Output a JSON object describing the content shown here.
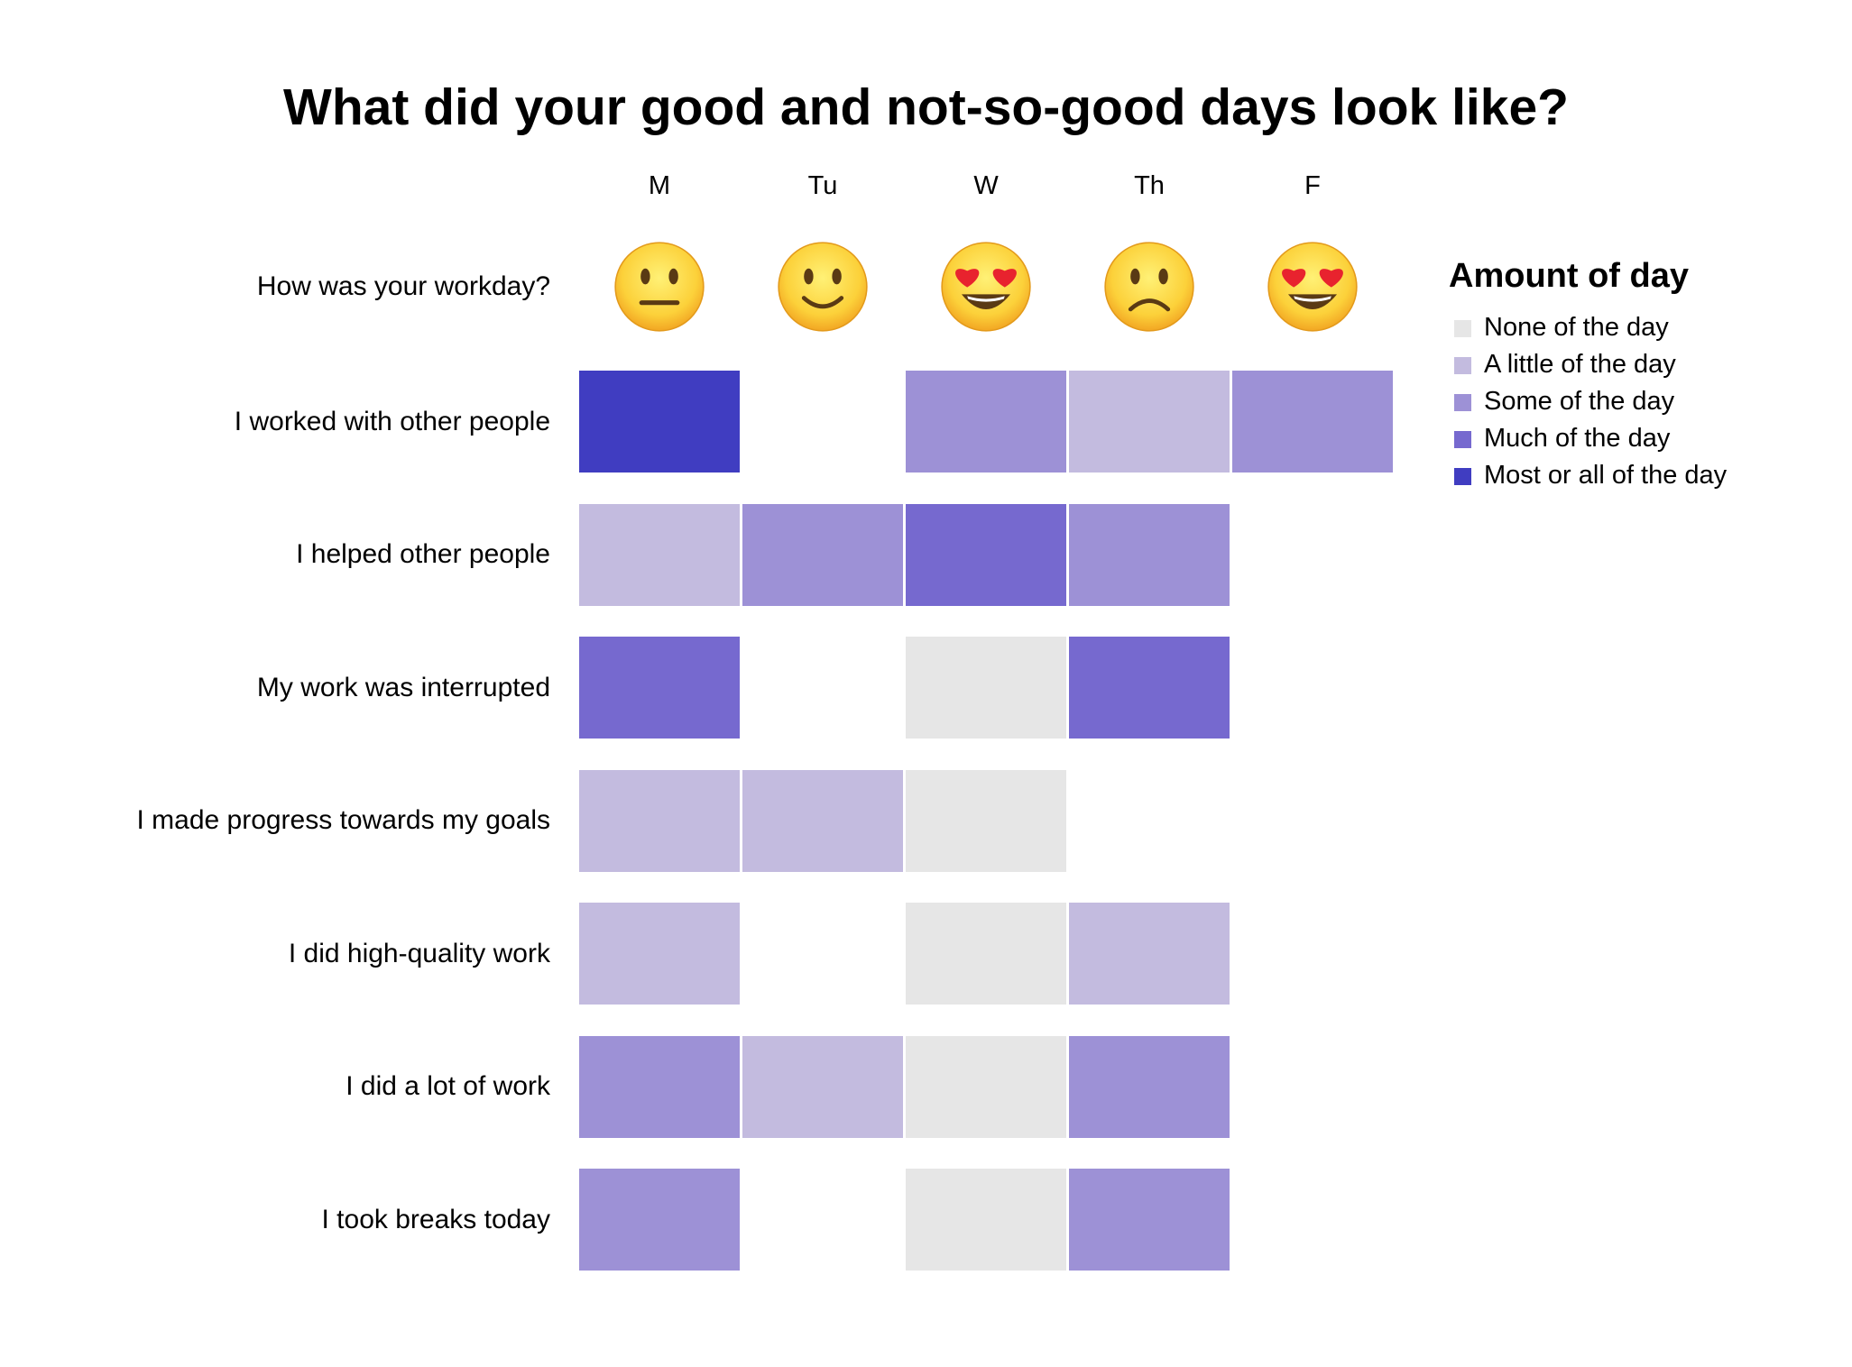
{
  "chart_data": {
    "type": "heatmap",
    "title": "What did your good and not-so-good days look like?",
    "days": [
      "M",
      "Tu",
      "W",
      "Th",
      "F"
    ],
    "mood_row": {
      "label": "How was your workday?",
      "values": [
        "neutral-face-icon",
        "slightly-smiling-face-icon",
        "heart-eyes-face-icon",
        "slightly-frowning-face-icon",
        "heart-eyes-face-icon"
      ]
    },
    "rows": [
      {
        "label": "I worked with other people",
        "values": [
          4,
          null,
          2,
          1,
          2
        ]
      },
      {
        "label": "I helped other people",
        "values": [
          1,
          2,
          3,
          2,
          null
        ]
      },
      {
        "label": "My work was interrupted",
        "values": [
          3,
          null,
          0,
          3,
          null
        ]
      },
      {
        "label": "I made progress towards my goals",
        "values": [
          1,
          1,
          0,
          null,
          null
        ]
      },
      {
        "label": "I did high-quality work",
        "values": [
          1,
          null,
          0,
          1,
          null
        ]
      },
      {
        "label": "I did a lot of work",
        "values": [
          2,
          1,
          0,
          2,
          null
        ]
      },
      {
        "label": "I took breaks today",
        "values": [
          2,
          null,
          0,
          2,
          null
        ]
      }
    ],
    "legend": {
      "title": "Amount of day",
      "placement": "right",
      "levels": [
        {
          "label": "None of the day",
          "color": "#e6e6e6"
        },
        {
          "label": "A little of the day",
          "color": "#c3bbdf"
        },
        {
          "label": "Some of the day",
          "color": "#9d91d6"
        },
        {
          "label": "Much of the day",
          "color": "#7669cf"
        },
        {
          "label": "Most or all of the day",
          "color": "#403dc1"
        }
      ]
    }
  }
}
